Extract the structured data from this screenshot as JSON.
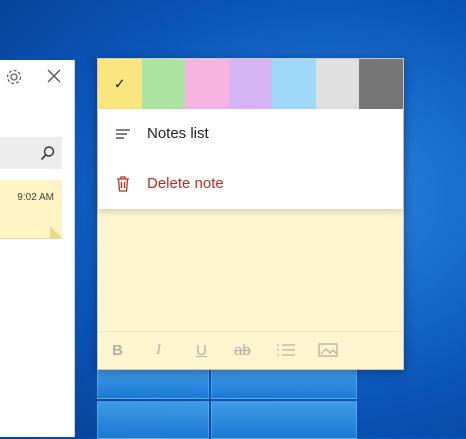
{
  "notes_window": {
    "settings_icon": "gear-icon",
    "close_icon": "close-icon",
    "search_icon": "search-icon",
    "note_time": "9:02 AM"
  },
  "sticky_note": {
    "colors": [
      {
        "name": "yellow",
        "hex": "#fbe57f",
        "selected": true
      },
      {
        "name": "green",
        "hex": "#abe5a0"
      },
      {
        "name": "pink",
        "hex": "#f7b3e2"
      },
      {
        "name": "purple",
        "hex": "#d7b4f5"
      },
      {
        "name": "blue",
        "hex": "#9fd8fb"
      },
      {
        "name": "gray",
        "hex": "#e0e0e0"
      },
      {
        "name": "charcoal",
        "hex": "#767676"
      }
    ],
    "check_glyph": "✓",
    "menu": {
      "notes_list_label": "Notes list",
      "delete_note_label": "Delete note",
      "delete_color": "#c42b1c"
    },
    "toolbar": {
      "bold": "B",
      "italic": "I",
      "underline": "U",
      "strikethrough": "ab"
    }
  }
}
